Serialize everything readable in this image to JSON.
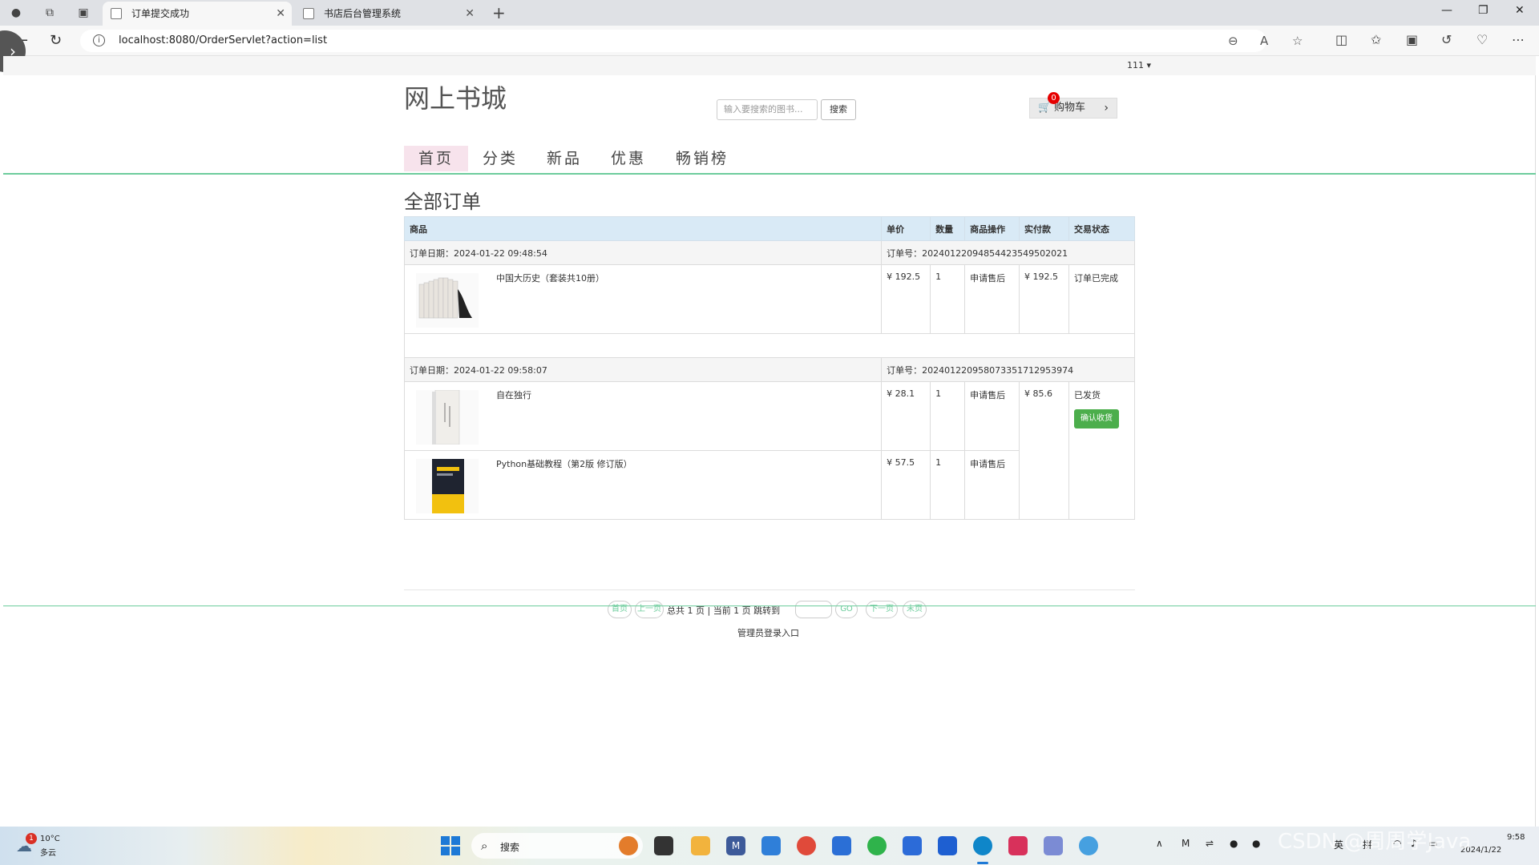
{
  "browser": {
    "tabs": [
      {
        "title": "订单提交成功",
        "active": true
      },
      {
        "title": "书店后台管理系统",
        "active": false
      }
    ],
    "url": "localhost:8080/OrderServlet?action=list"
  },
  "header": {
    "user_menu": "111 ▾",
    "site_title": "网上书城",
    "search_placeholder": "输入要搜索的图书...",
    "search_button": "搜索",
    "cart_label": "购物车",
    "cart_count": "0"
  },
  "nav": {
    "items": [
      {
        "label": "首页",
        "active": true
      },
      {
        "label": "分类",
        "active": false
      },
      {
        "label": "新品",
        "active": false
      },
      {
        "label": "优惠",
        "active": false
      },
      {
        "label": "畅销榜",
        "active": false
      }
    ]
  },
  "orders_section": {
    "title": "全部订单",
    "columns": [
      "商品",
      "单价",
      "数量",
      "商品操作",
      "实付款",
      "交易状态"
    ],
    "orders": [
      {
        "date": "订单日期：2024-01-22 09:48:54",
        "number": "订单号：20240122094854423549502021",
        "items": [
          {
            "name": "中国大历史（套装共10册）",
            "price": "¥ 192.5",
            "qty": "1",
            "action": "申请售后"
          }
        ],
        "paid": "¥ 192.5",
        "status": "订单已完成",
        "button": ""
      },
      {
        "date": "订单日期：2024-01-22 09:58:07",
        "number": "订单号：20240122095807335171295397​4",
        "items": [
          {
            "name": "自在独行",
            "price": "¥ 28.1",
            "qty": "1",
            "action": "申请售后"
          },
          {
            "name": "Python基础教程（第2版 修订版）",
            "price": "¥ 57.5",
            "qty": "1",
            "action": "申请售后"
          }
        ],
        "paid": "¥ 85.6",
        "status": "已发货",
        "button": "确认收货"
      }
    ]
  },
  "pager": {
    "first": "首页",
    "prev": "上一页",
    "info": "总共 1 页 | 当前 1 页 跳转到",
    "go": "GO",
    "next": "下一页",
    "last": "末页"
  },
  "footer": {
    "admin_link": "管理员登录入口"
  },
  "taskbar": {
    "weather_temp": "10°C",
    "weather_desc": "多云",
    "weather_badge": "1",
    "search_text": "搜索",
    "tray_lang1": "英",
    "tray_lang2": "拼",
    "time": "9:58",
    "date": "2024/1/22"
  },
  "watermark": "CSDN @周周学Java"
}
